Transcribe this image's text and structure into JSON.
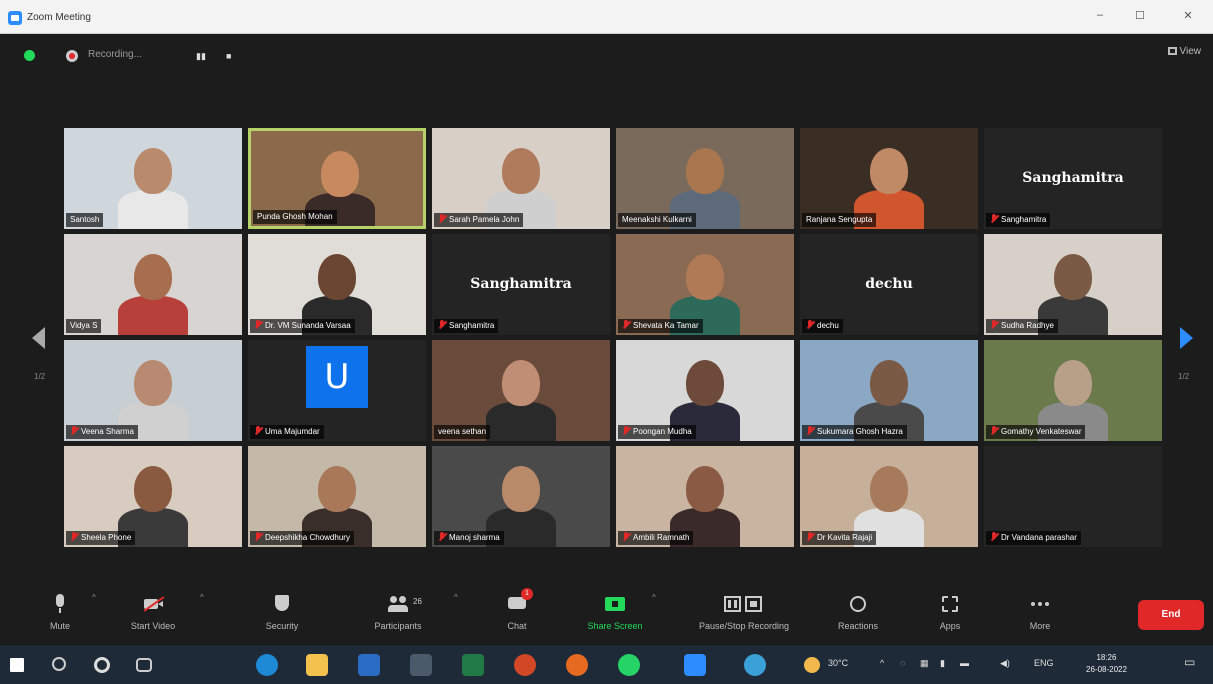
{
  "window": {
    "title": "Zoom Meeting",
    "min": "–",
    "max": "☐",
    "close": "✕"
  },
  "recording": {
    "label": "Recording...",
    "pause": "▮▮",
    "stop": "■"
  },
  "view_label": "View",
  "page_indicator_left": "1/2",
  "page_indicator_right": "1/2",
  "participants": [
    {
      "name": "Santosh",
      "muted": false,
      "bg": "#cfd6dc",
      "skin": "#b98a6c",
      "shirt": "#e8e8e8",
      "type": "video"
    },
    {
      "name": "Punda Ghosh Mohan",
      "muted": false,
      "bg": "#8a6a4a",
      "skin": "#c9895f",
      "shirt": "#3a2a28",
      "type": "video",
      "active": true
    },
    {
      "name": "Sarah Pamela John",
      "muted": true,
      "bg": "#d8cfc6",
      "skin": "#b07a5c",
      "shirt": "#cfcfcf",
      "type": "video"
    },
    {
      "name": "Meenakshi Kulkarni",
      "muted": false,
      "bg": "#7a6a5c",
      "skin": "#a8764f",
      "shirt": "#5c6a7a",
      "type": "video"
    },
    {
      "name": "Ranjana Sengupta",
      "muted": false,
      "bg": "#3a2e24",
      "skin": "#c08a66",
      "shirt": "#d0562e",
      "type": "video"
    },
    {
      "name": "Sanghamitra",
      "muted": true,
      "type": "name",
      "big": "Sanghamitra"
    },
    {
      "name": "Vidya S",
      "muted": false,
      "bg": "#d8d4d2",
      "skin": "#a66e4e",
      "shirt": "#b8403a",
      "type": "video"
    },
    {
      "name": "Dr. VM Sunanda Varsaa",
      "muted": true,
      "bg": "#e0ddd8",
      "skin": "#6a4632",
      "shirt": "#2a2a2a",
      "type": "video"
    },
    {
      "name": "Sanghamitra",
      "muted": true,
      "type": "name",
      "big": "Sanghamitra"
    },
    {
      "name": "Shevata Ka Tamar",
      "muted": true,
      "bg": "#8a6a52",
      "skin": "#b07a56",
      "shirt": "#2e6a5a",
      "type": "video"
    },
    {
      "name": "dechu",
      "muted": true,
      "type": "name",
      "big": "dechu"
    },
    {
      "name": "Sudha Radhye",
      "muted": true,
      "bg": "#d6d0c8",
      "skin": "#7a5a44",
      "shirt": "#3a3a3a",
      "type": "video"
    },
    {
      "name": "Veena Sharma",
      "muted": true,
      "bg": "#c8cfd4",
      "skin": "#b88a72",
      "shirt": "#d0d0d0",
      "type": "video"
    },
    {
      "name": "Uma Majumdar",
      "muted": true,
      "type": "avatar",
      "letter": "U"
    },
    {
      "name": "veena sethan",
      "muted": false,
      "bg": "#6a4a3a",
      "skin": "#c08e74",
      "shirt": "#2a2a2a",
      "type": "video"
    },
    {
      "name": "Poongan Mudha",
      "muted": true,
      "bg": "#d8d8d8",
      "skin": "#6e4a3a",
      "shirt": "#2a2a3a",
      "type": "video"
    },
    {
      "name": "Sukumara Ghosh Hazra",
      "muted": true,
      "bg": "#8aa8c4",
      "skin": "#7a5a44",
      "shirt": "#4a4a4a",
      "type": "video"
    },
    {
      "name": "Gomathy Venkateswar",
      "muted": true,
      "bg": "#6a7a4a",
      "skin": "#b8a088",
      "shirt": "#8a8a8a",
      "type": "video"
    },
    {
      "name": "Sheela Phone",
      "muted": true,
      "bg": "#d8ccc0",
      "skin": "#8a5a40",
      "shirt": "#3a3a3a",
      "type": "video"
    },
    {
      "name": "Deepshikha Chowdhury",
      "muted": true,
      "bg": "#c4b8a8",
      "skin": "#a87858",
      "shirt": "#3a2e2a",
      "type": "video"
    },
    {
      "name": "Manoj sharma",
      "muted": true,
      "bg": "#4a4a4a",
      "skin": "#b88a6a",
      "shirt": "#2a2a2a",
      "type": "video"
    },
    {
      "name": "Ambili Ramnath",
      "muted": true,
      "bg": "#c8b4a0",
      "skin": "#8a5a44",
      "shirt": "#3a2a2a",
      "type": "video"
    },
    {
      "name": "Dr Kavita Rajaji",
      "muted": true,
      "bg": "#c6b09a",
      "skin": "#a87a5c",
      "shirt": "#e0e0e0",
      "type": "video"
    },
    {
      "name": "Dr Vandana parashar",
      "muted": true,
      "type": "blank"
    }
  ],
  "toolbar": {
    "mute": "Mute",
    "start_video": "Start Video",
    "security": "Security",
    "participants": "Participants",
    "participants_count": "26",
    "chat": "Chat",
    "chat_badge": "1",
    "share_screen": "Share Screen",
    "pause_stop_recording": "Pause/Stop Recording",
    "reactions": "Reactions",
    "apps": "Apps",
    "more": "More",
    "end": "End"
  },
  "taskbar": {
    "weather": "30°C",
    "language": "ENG",
    "time": "18:26",
    "date": "26-08-2022"
  },
  "colors": {
    "zoom_blue": "#2d8cff",
    "active_speaker": "#b8d26a",
    "end_red": "#e02828",
    "share_green": "#23d959"
  }
}
